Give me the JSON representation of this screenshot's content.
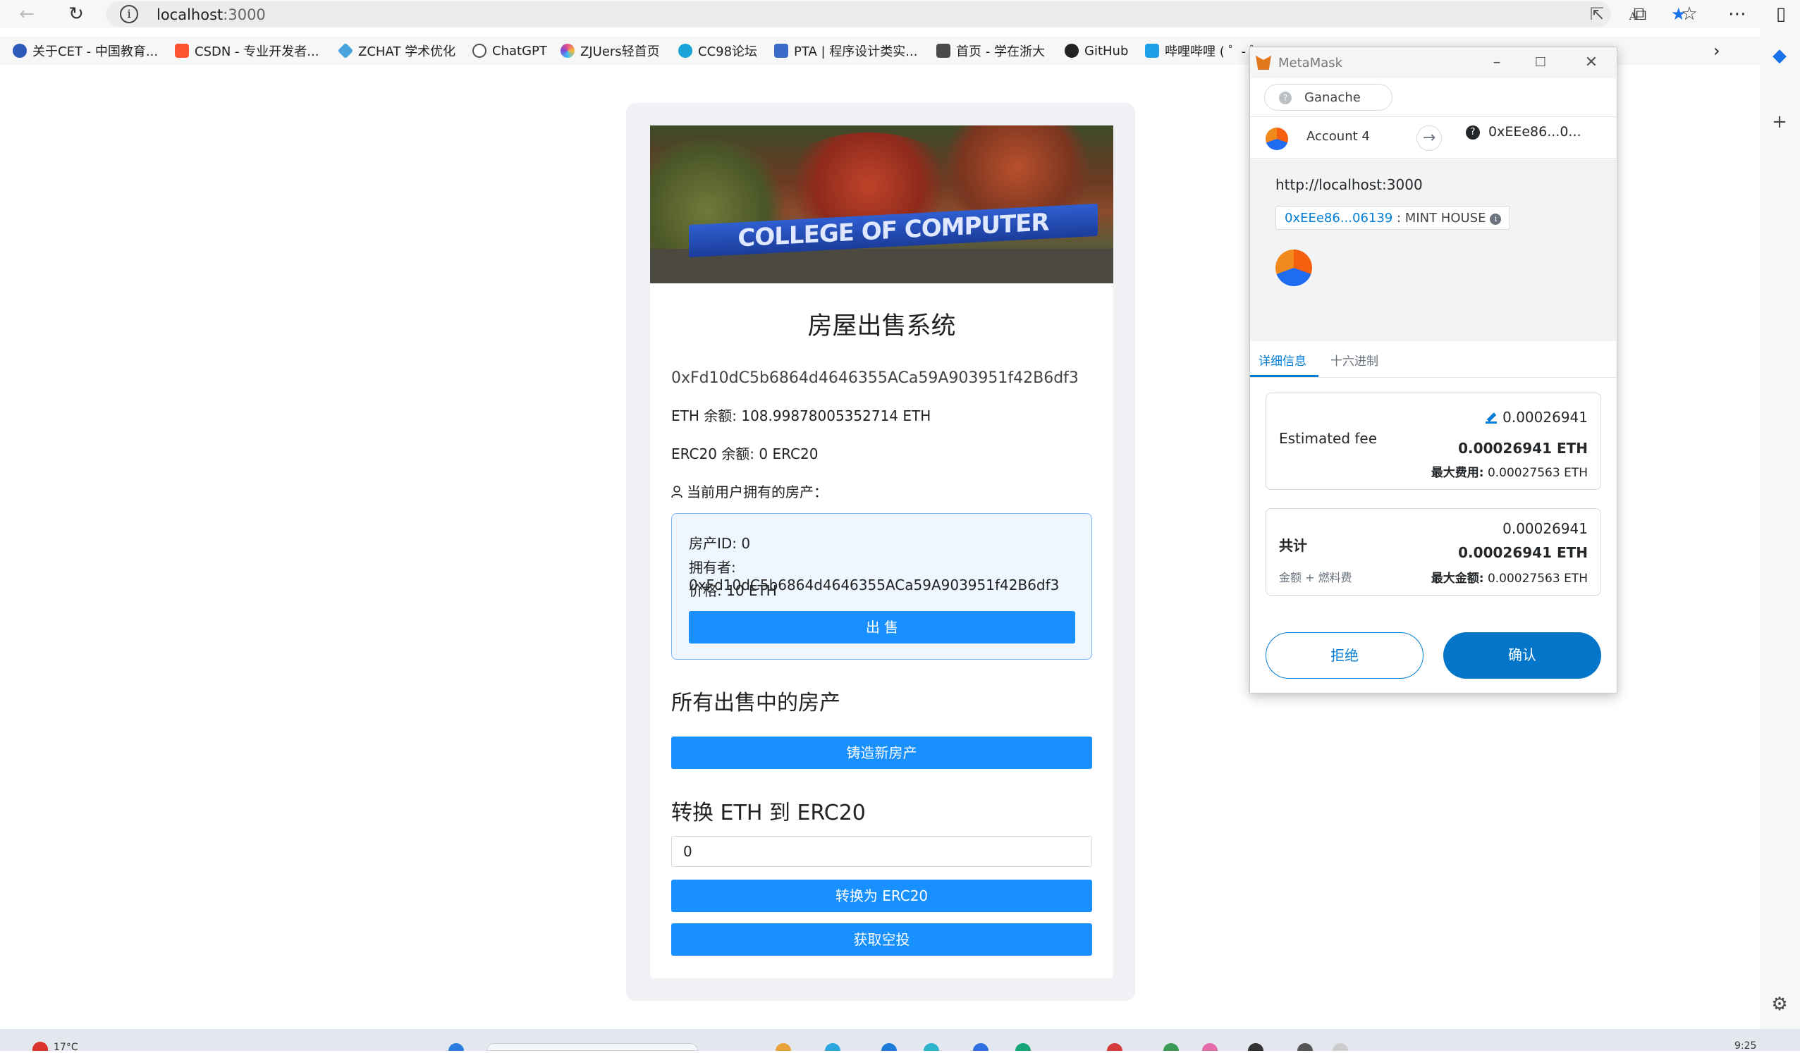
{
  "browser": {
    "url_host": "localhost",
    "url_port": ":3000"
  },
  "bookmarks": [
    {
      "label": "关于CET - 中国教育...",
      "color": "#2a5bb8"
    },
    {
      "label": "CSDN - 专业开发者...",
      "color": "#fc5531"
    },
    {
      "label": "ZCHAT 学术优化",
      "color": "#4aa3df"
    },
    {
      "label": "ChatGPT",
      "color": "#555555"
    },
    {
      "label": "ZJUers轻首页",
      "color": "#e94f8a"
    },
    {
      "label": "CC98论坛",
      "color": "#1aa3d9"
    },
    {
      "label": "PTA | 程序设计类实...",
      "color": "#3b6cc9"
    },
    {
      "label": "首页 - 学在浙大",
      "color": "#4a4a4a"
    },
    {
      "label": "GitHub",
      "color": "#222222"
    },
    {
      "label": "哔哩哔哩 ( ゜- ゜",
      "color": "#1ea0e6"
    }
  ],
  "dapp": {
    "title": "房屋出售系统",
    "account_address": "0xFd10dC5b6864d4646355ACa59A903951f42B6df3",
    "eth_balance": "ETH 余额: 108.99878005352714 ETH",
    "erc20_balance": "ERC20 余额: 0 ERC20",
    "owned_heading": "当前用户拥有的房产：",
    "house": {
      "id_line": "房产ID: 0",
      "owner_line": "拥有者: 0xFd10dC5b6864d4646355ACa59A903951f42B6df3",
      "price_line": "价格: 10 ETH",
      "sell_label": "出 售"
    },
    "for_sale_heading": "所有出售中的房产",
    "mint_label": "铸造新房产",
    "convert_heading": "转换 ETH 到 ERC20",
    "convert_value": "0",
    "convert_label": "转换为 ERC20",
    "airdrop_label": "获取空投"
  },
  "metamask": {
    "window_title": "MetaMask",
    "network": "Ganache",
    "account_name": "Account 4",
    "to_address": "0xEEe86...0...",
    "origin": "http://localhost:3000",
    "contract_short": "0xEEe86...06139",
    "method": ": MINT HOUSE",
    "tab_details": "详细信息",
    "tab_hex": "十六进制",
    "fee_label": "Estimated fee",
    "fee_small": "0.00026941",
    "fee_bold": "0.00026941 ETH",
    "max_fee_label": "最大费用:",
    "max_fee_value": "0.00027563 ETH",
    "total_label": "共计",
    "total_sub": "金额 + 燃料费",
    "total_small": "0.00026941",
    "total_bold": "0.00026941 ETH",
    "max_amount_label": "最大金额:",
    "max_amount_value": "0.00027563 ETH",
    "reject_label": "拒绝",
    "confirm_label": "确认"
  },
  "taskbar": {
    "temperature": "17°C",
    "clock": "9:25"
  }
}
